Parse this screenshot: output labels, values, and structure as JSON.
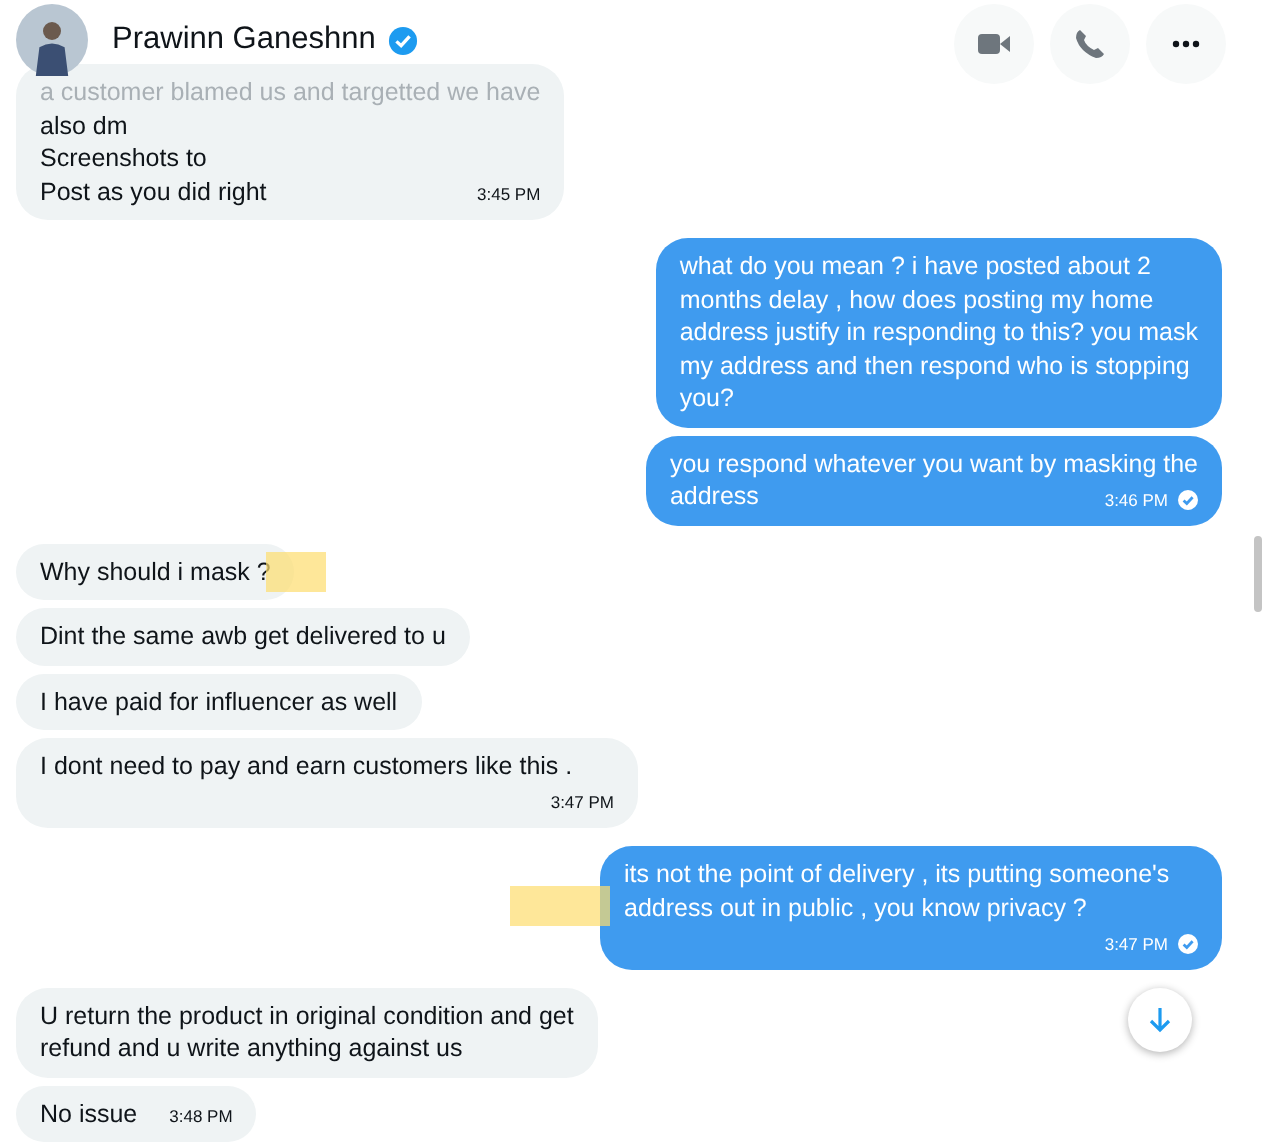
{
  "header": {
    "name": "Prawinn Ganeshnn",
    "verified": true,
    "actions": [
      {
        "kind": "video"
      },
      {
        "kind": "call"
      },
      {
        "kind": "more"
      }
    ]
  },
  "messages": [
    {
      "kind": "incoming",
      "lines": [
        "a customer blamed us and targetted we have",
        "also dm",
        "Screenshots to",
        "Post as you did right"
      ],
      "partly_hidden": true,
      "time": "3:45 PM"
    },
    {
      "kind": "outgoing",
      "lines": [
        "what do you mean ? i have posted about 2",
        "months delay , how does posting my home",
        "address justify in responding to this? you mask",
        "my address and then respond who is stopping",
        "you?"
      ]
    },
    {
      "kind": "outgoing",
      "lines": [
        "you respond whatever you want by masking the",
        "address"
      ],
      "time": "3:46 PM",
      "read": true
    },
    {
      "kind": "incoming",
      "lines": [
        "Why should i mask ?"
      ],
      "highlight": true
    },
    {
      "kind": "incoming",
      "lines": [
        "Dint the same awb get delivered to u"
      ]
    },
    {
      "kind": "incoming",
      "lines": [
        "I have paid for influencer as well"
      ]
    },
    {
      "kind": "incoming",
      "lines": [
        "I dont need to pay and earn customers like this ."
      ],
      "time": "3:47 PM"
    },
    {
      "kind": "outgoing",
      "lines": [
        "its not the point of delivery , its putting someone's",
        "address out in public , you know privacy ?"
      ],
      "time": "3:47 PM",
      "read": true,
      "highlight": true
    },
    {
      "kind": "incoming",
      "lines": [
        "U return the product in original condition and get",
        "refund and u write anything against us"
      ]
    },
    {
      "kind": "incoming",
      "lines": [
        "No issue"
      ],
      "time": "3:48 PM"
    }
  ]
}
